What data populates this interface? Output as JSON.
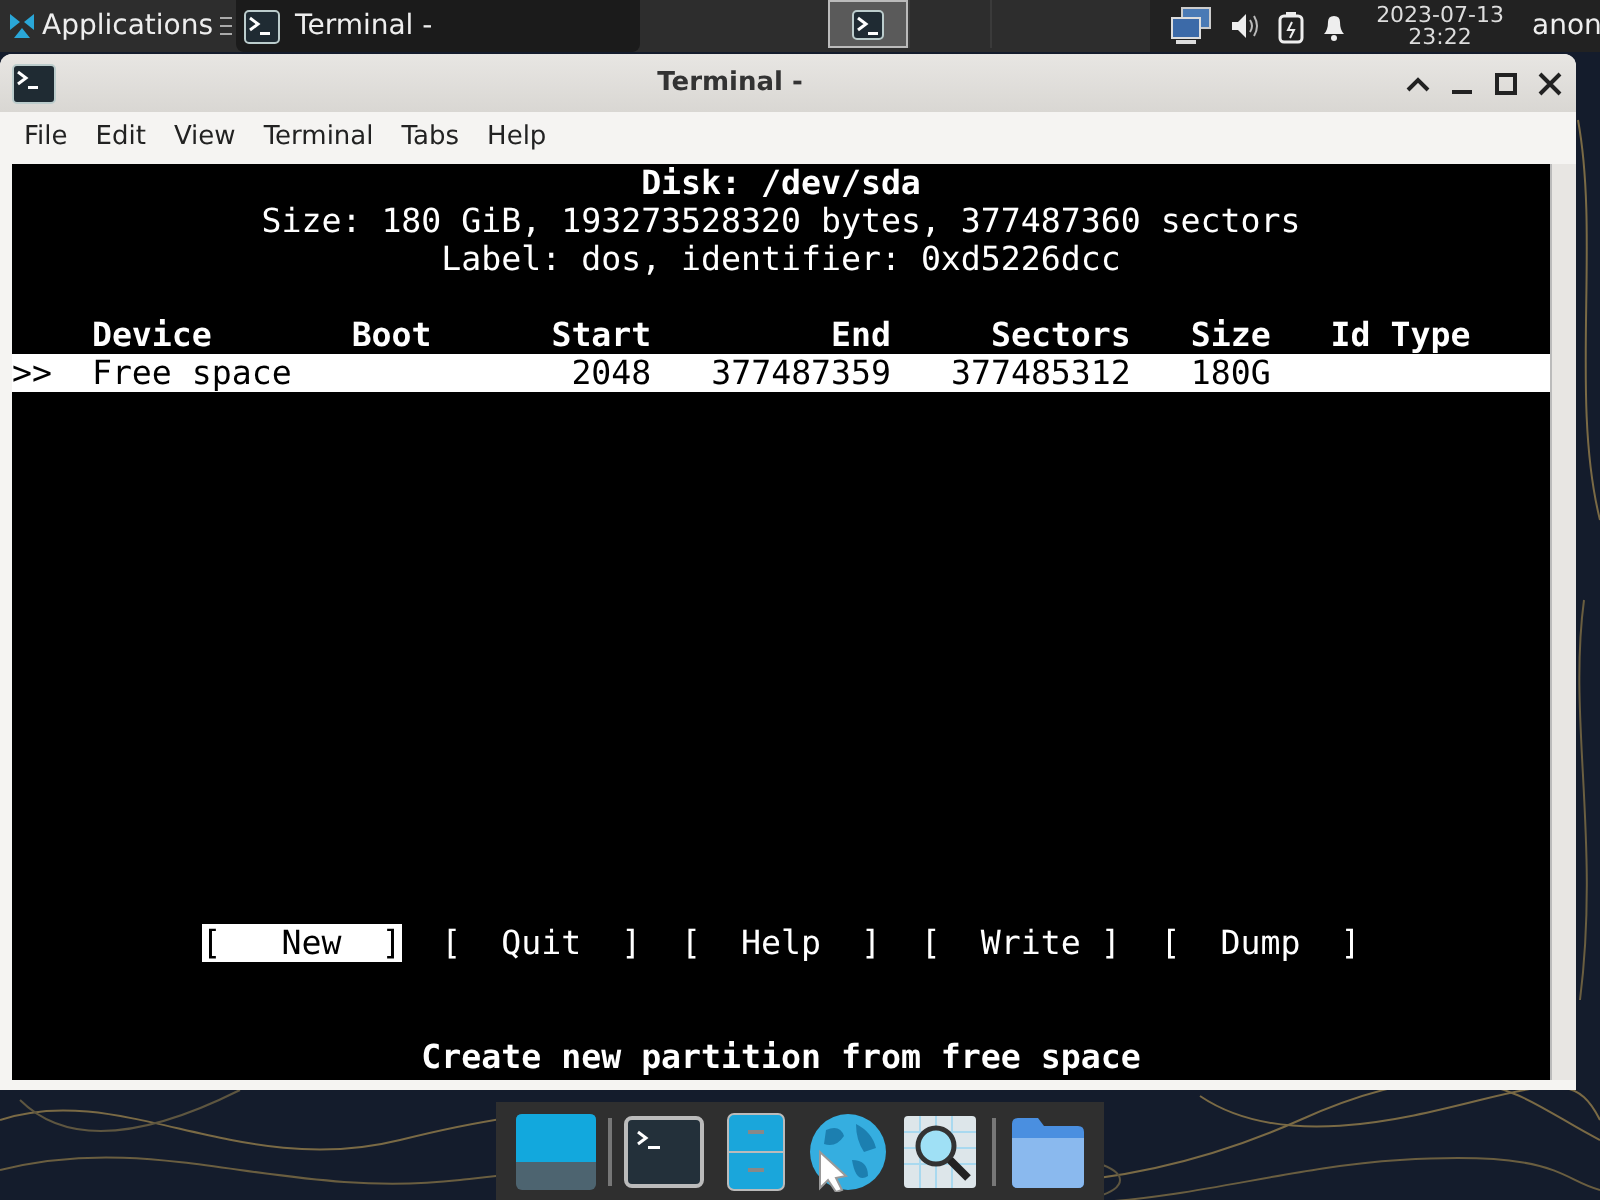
{
  "panel": {
    "applications_label": "Applications",
    "tasks": [
      {
        "title": "Terminal -",
        "selected": false
      }
    ],
    "workspaces": [
      {
        "selected": true
      },
      {
        "selected": false
      },
      {
        "selected": false
      }
    ],
    "clock": {
      "date": "2023-07-13",
      "time": "23:22"
    },
    "user": "anon"
  },
  "window": {
    "title": "Terminal -",
    "menu": [
      "File",
      "Edit",
      "View",
      "Terminal",
      "Tabs",
      "Help"
    ]
  },
  "terminal": {
    "disk_line": "Disk: /dev/sda",
    "size_line": "Size: 180 GiB, 193273528320 bytes, 377487360 sectors",
    "label_line": "Label: dos, identifier: 0xd5226dcc",
    "columns": [
      "Device",
      "Boot",
      "Start",
      "End",
      "Sectors",
      "Size",
      "Id Type"
    ],
    "rows": [
      {
        "marker": ">>",
        "device": "Free space",
        "start": "2048",
        "end": "377487359",
        "sectors": "377485312",
        "size": "180G",
        "selected": true
      }
    ],
    "buttons": [
      {
        "label": "[   New  ]",
        "selected": true
      },
      {
        "label": "[  Quit  ]",
        "selected": false
      },
      {
        "label": "[  Help  ]",
        "selected": false
      },
      {
        "label": "[  Write ]",
        "selected": false
      },
      {
        "label": "[  Dump  ]",
        "selected": false
      }
    ],
    "status": "Create new partition from free space"
  },
  "dock": {
    "items": [
      {
        "kind": "desktop"
      },
      {
        "kind": "terminal"
      },
      {
        "kind": "cabinet"
      },
      {
        "kind": "globe"
      },
      {
        "kind": "search"
      },
      {
        "kind": "folder"
      }
    ]
  }
}
